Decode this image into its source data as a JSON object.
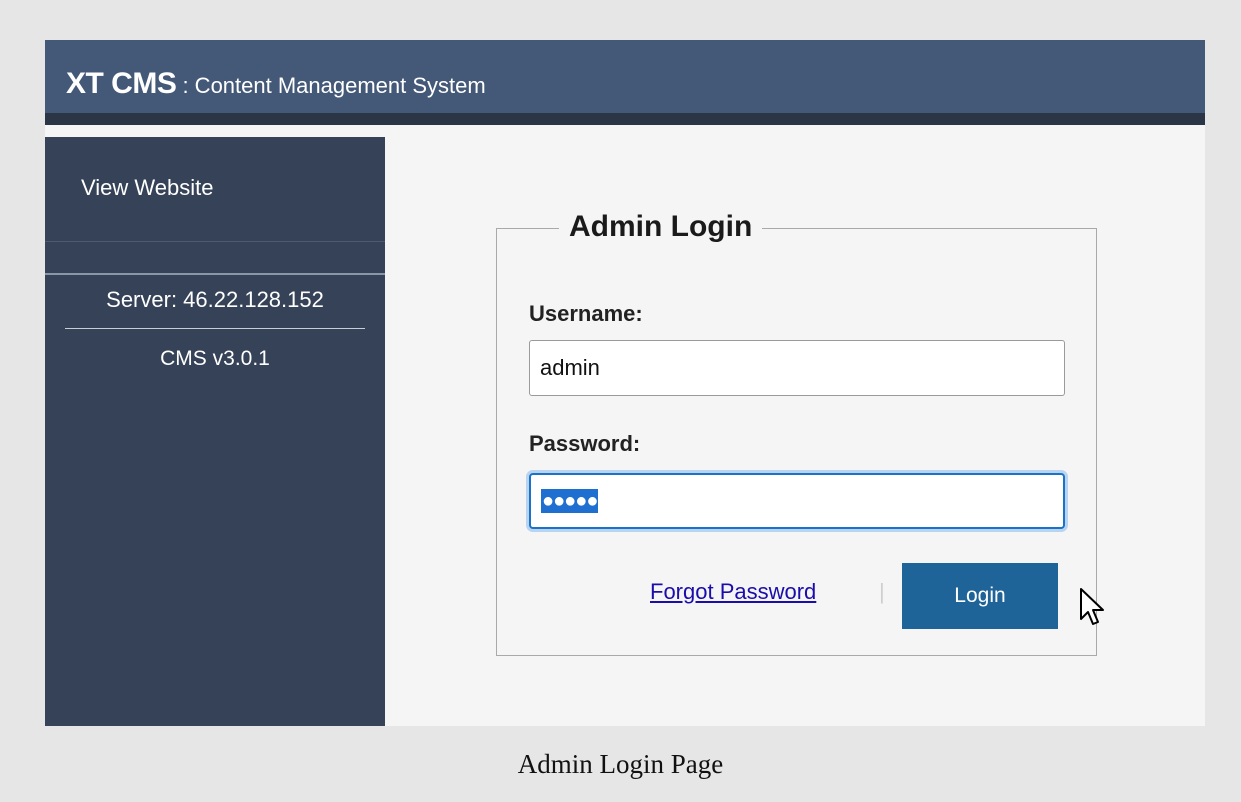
{
  "header": {
    "brand": "XT CMS",
    "subtitle": " : Content Management System"
  },
  "sidebar": {
    "view_website": "View Website",
    "server": "Server: 46.22.128.152",
    "version": "CMS v3.0.1"
  },
  "login": {
    "legend": "Admin Login",
    "username_label": "Username:",
    "username_value": "admin",
    "password_label": "Password:",
    "password_mask": "●●●●●",
    "forgot_label": "Forgot Password",
    "separator": "|",
    "login_label": "Login"
  },
  "icons": {
    "cursor": "arrow-cursor-icon"
  },
  "colors": {
    "header_bg": "#445878",
    "sidebar_bg": "#354257",
    "button_bg": "#1e6499",
    "focus_border": "#1a73c9",
    "link": "#1a0dab"
  },
  "caption": "Admin Login Page"
}
